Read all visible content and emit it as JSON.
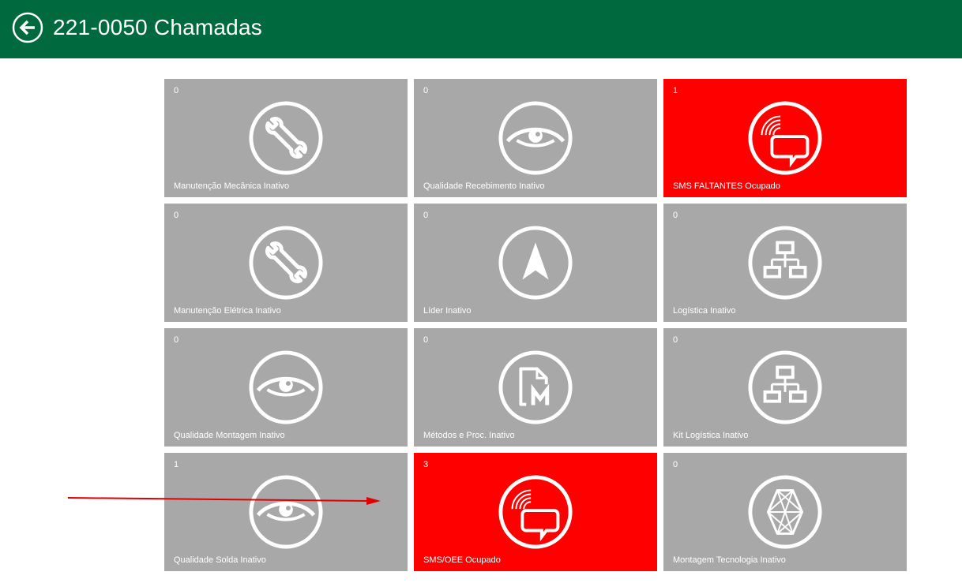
{
  "header": {
    "title": "221-0050 Chamadas",
    "back_icon": "back-arrow-icon",
    "background": "#006a3e"
  },
  "colors": {
    "inactive": "#a8a8a8",
    "busy": "#ff0000"
  },
  "tiles": [
    {
      "count": "0",
      "label": "Manutenção Mecânica Inativo",
      "icon": "wrench-icon",
      "state": "inactive"
    },
    {
      "count": "0",
      "label": "Qualidade Recebimento Inativo",
      "icon": "eye-icon",
      "state": "inactive"
    },
    {
      "count": "1",
      "label": "SMS FALTANTES Ocupado",
      "icon": "sms-chat-icon",
      "state": "busy"
    },
    {
      "count": "0",
      "label": "Manutenção Elétrica Inativo",
      "icon": "wrench-icon",
      "state": "inactive"
    },
    {
      "count": "0",
      "label": "Líder Inativo",
      "icon": "navigation-arrow-icon",
      "state": "inactive"
    },
    {
      "count": "0",
      "label": "Logística Inativo",
      "icon": "hierarchy-icon",
      "state": "inactive"
    },
    {
      "count": "0",
      "label": "Qualidade Montagem Inativo",
      "icon": "eye-icon",
      "state": "inactive"
    },
    {
      "count": "0",
      "label": "Métodos e Proc. Inativo",
      "icon": "document-m-icon",
      "state": "inactive"
    },
    {
      "count": "0",
      "label": "Kit Logística Inativo",
      "icon": "hierarchy-icon",
      "state": "inactive"
    },
    {
      "count": "1",
      "label": "Qualidade Solda Inativo",
      "icon": "eye-icon",
      "state": "inactive"
    },
    {
      "count": "3",
      "label": "SMS/OEE Ocupado",
      "icon": "sms-chat-icon",
      "state": "busy"
    },
    {
      "count": "0",
      "label": "Montagem Tecnologia Inativo",
      "icon": "geometric-network-icon",
      "state": "inactive"
    }
  ]
}
